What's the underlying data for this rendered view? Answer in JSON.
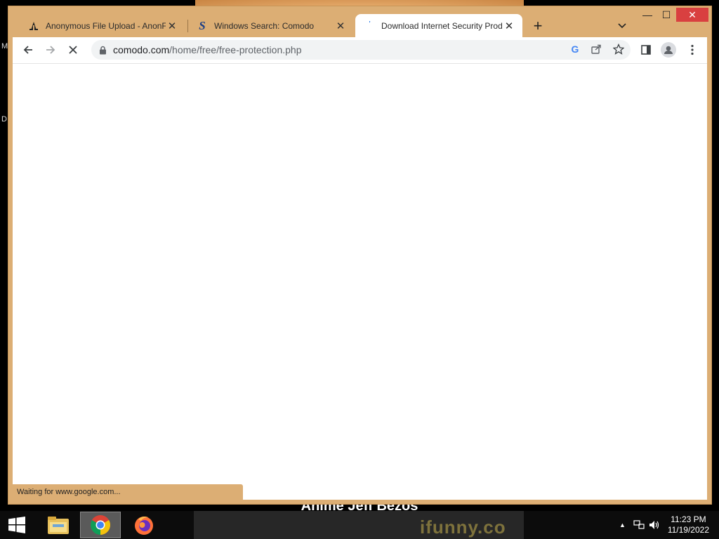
{
  "desktop": {
    "left_letters": [
      "M",
      "D"
    ],
    "meme_caption": "Anime Jeff Bezos",
    "watermark": "ifunny.co"
  },
  "browser": {
    "tabs": [
      {
        "title": "Anonymous File Upload - AnonFiles",
        "favicon": "anonfiles-icon",
        "active": false
      },
      {
        "title": "Windows Search: Comodo",
        "favicon": "search-s-icon",
        "active": false
      },
      {
        "title": "Download Internet Security Products",
        "favicon": "loading-spinner-icon",
        "active": true
      }
    ],
    "new_tab_label": "+",
    "tab_search_icon": "chevron-down-icon",
    "window_controls": {
      "minimize": "—",
      "maximize": "☐",
      "close": "✕"
    },
    "toolbar": {
      "back_icon": "back-arrow-icon",
      "forward_icon": "forward-arrow-icon",
      "stop_icon": "stop-loading-icon",
      "url_host": "comodo.com",
      "url_path": "/home/free/free-protection.php"
    },
    "status": "Waiting for www.google.com..."
  },
  "taskbar": {
    "time": "11:23 PM",
    "date": "11/19/2022"
  },
  "colors": {
    "frame": "#dcae74",
    "active_tab": "#ffffff",
    "close_button": "#d94040",
    "taskbar": "#0c0c0c"
  }
}
